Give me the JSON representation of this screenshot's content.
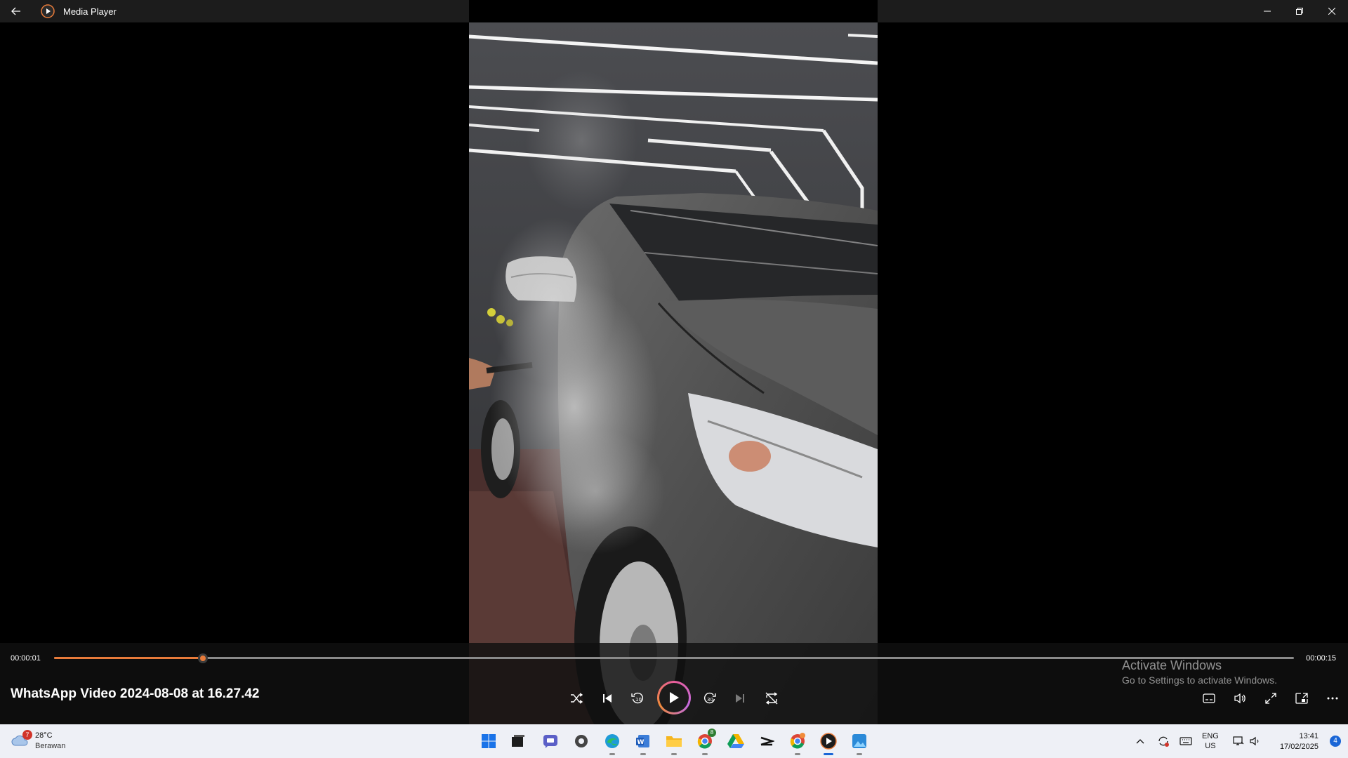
{
  "window": {
    "title": "Media Player",
    "controls": [
      "minimize-icon",
      "restore-icon",
      "close-icon"
    ]
  },
  "player": {
    "current_time": "00:00:01",
    "total_time": "00:00:15",
    "progress_fraction": 0.12,
    "video_title": "WhatsApp Video 2024-08-08 at 16.27.42",
    "accent_color": "#e87b3a",
    "playback_buttons": [
      "shuffle-icon",
      "previous-icon",
      "rewind-10-icon",
      "play-icon",
      "forward-30-icon",
      "next-icon",
      "repeat-off-icon"
    ],
    "right_buttons": [
      "subtitles-icon",
      "volume-icon",
      "fullscreen-icon",
      "mini-player-icon",
      "more-icon"
    ]
  },
  "watermark": {
    "line1": "Activate Windows",
    "line2": "Go to Settings to activate Windows."
  },
  "taskbar": {
    "weather": {
      "badge": "7",
      "temp": "28°C",
      "condition": "Berawan"
    },
    "apps": [
      "start-icon",
      "task-view-icon",
      "chat-icon",
      "settings-app-icon",
      "edge-icon",
      "word-icon",
      "file-explorer-icon",
      "chrome-icon",
      "google-drive-icon",
      "capcut-icon",
      "chrome-profile-icon",
      "media-player-icon",
      "photos-icon"
    ],
    "chrome_badge": "8",
    "tray": {
      "lang_line1": "ENG",
      "lang_line2": "US",
      "time": "13:41",
      "date": "17/02/2025",
      "notification_count": "4"
    }
  }
}
